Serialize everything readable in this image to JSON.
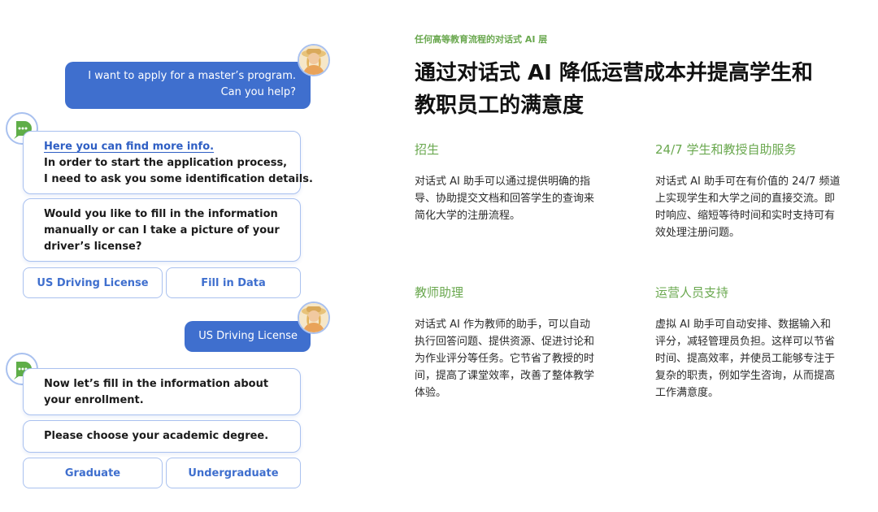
{
  "chat": {
    "user_message_1": {
      "line1": "I want to apply for a master’s program.",
      "line2": "Can you help?"
    },
    "bot_message_1": {
      "link": "Here you can find more info.",
      "line2": "In order to start the application process,",
      "line3": "I need to ask you some identification details."
    },
    "bot_message_2": {
      "line1": "Would you like to fill in the information",
      "line2": "manually or can I take a picture of your",
      "line3": "driver’s license?"
    },
    "options_1": [
      "US Driving License",
      "Fill in Data"
    ],
    "user_message_2": "US Driving License",
    "bot_message_3": {
      "line1": "Now let’s fill in the information about",
      "line2": "your enrollment."
    },
    "bot_message_4": "Please choose your academic degree.",
    "options_2": [
      "Graduate",
      "Undergraduate"
    ]
  },
  "content": {
    "eyebrow": "任何高等教育流程的对话式 AI 层",
    "headline": {
      "line1": "通过对话式 AI 降低运营成本并提高学生和",
      "line2": "教职员工的满意度"
    },
    "sections": [
      {
        "title": "招生",
        "lines": [
          "对话式 AI 助手可以通过提供明确的指",
          "导、协助提交文档和回答学生的查询来",
          "简化大学的注册流程。"
        ]
      },
      {
        "title": "24/7 学生和教授自助服务",
        "lines": [
          "对话式 AI 助手可在有价值的 24/7 频道",
          "上实现学生和大学之间的直接交流。即",
          "时响应、缩短等待时间和实时支持可有",
          "效处理注册问题。"
        ]
      },
      {
        "title": "教师助理",
        "lines": [
          "对话式 AI 作为教师的助手，可以自动",
          "执行回答问题、提供资源、促进讨论和",
          "为作业评分等任务。它节省了教授的时",
          "间，提高了课堂效率，改善了整体教学",
          "体验。"
        ]
      },
      {
        "title": "运营人员支持",
        "lines": [
          "虚拟 AI 助手可自动安排、数据输入和",
          "评分，减轻管理员负担。这样可以节省",
          "时间、提高效率，并使员工能够专注于",
          "复杂的职责，例如学生咨询，从而提高",
          "工作满意度。"
        ]
      }
    ]
  },
  "colors": {
    "accent_blue": "#3f6fce",
    "bubble_border": "#a9c1ef",
    "section_green": "#6aa84f",
    "bot_icon_green": "#5fae48"
  }
}
